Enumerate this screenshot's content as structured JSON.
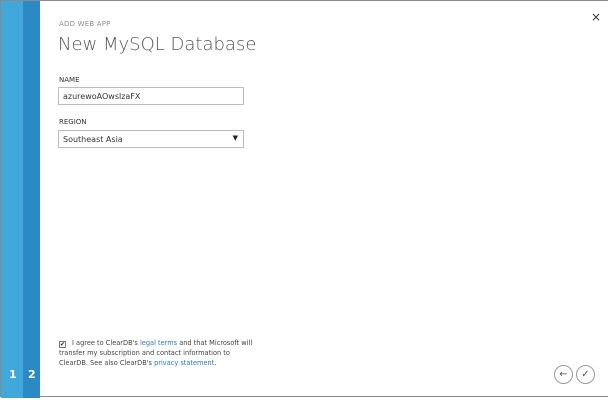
{
  "wizard": {
    "steps": [
      "1",
      "2"
    ],
    "subtitle": "ADD WEB APP",
    "title": "New MySQL Database"
  },
  "form": {
    "name_label": "NAME",
    "name_value": "azurewoAOwslzaFX",
    "region_label": "REGION",
    "region_value": "Southeast Asia"
  },
  "agreement": {
    "checked": true,
    "text1": "I agree to ClearDB's ",
    "link1": "legal terms",
    "text2": " and that Microsoft will transfer my subscription and contact information to ClearDB. See also ClearDB's ",
    "link2": "privacy statement",
    "text3": "."
  },
  "icons": {
    "close": "×",
    "back": "←",
    "confirm": "✓",
    "checkbox": "✔",
    "dropdown": "▼"
  }
}
